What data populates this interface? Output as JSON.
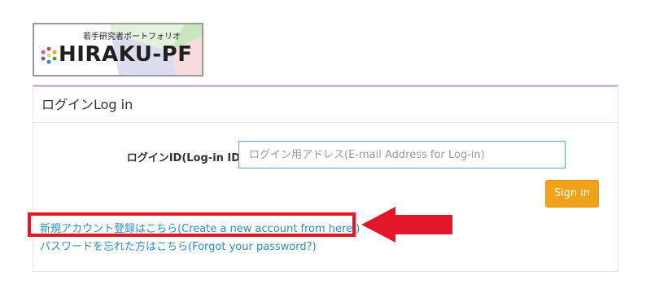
{
  "logo": {
    "tagline": "若手研究者ポートフォリオ",
    "wordmark": "HIRAKU-PF"
  },
  "panel": {
    "heading": "ログインLog in"
  },
  "login_form": {
    "id_label": "ログインID(Log-in ID)",
    "id_placeholder": "ログイン用アドレス(E-mail Address for Log-in)",
    "id_value": "",
    "signin_label": "Sign in"
  },
  "links": {
    "create_account": "新規アカウント登録はこちら(Create a new account from here.)",
    "forgot_password": "パスワードを忘れた方はこちら(Forgot your password?)"
  },
  "colors": {
    "accent_orange": "#f0a21b",
    "link_blue": "#2a8fc4",
    "input_border": "#64a6c6",
    "annotation_red": "#e3172a",
    "panel_top": "#cfb8d8"
  },
  "icons": {
    "logo_dots": "flower-dots-icon",
    "annotation_arrow": "left-arrow-icon"
  }
}
